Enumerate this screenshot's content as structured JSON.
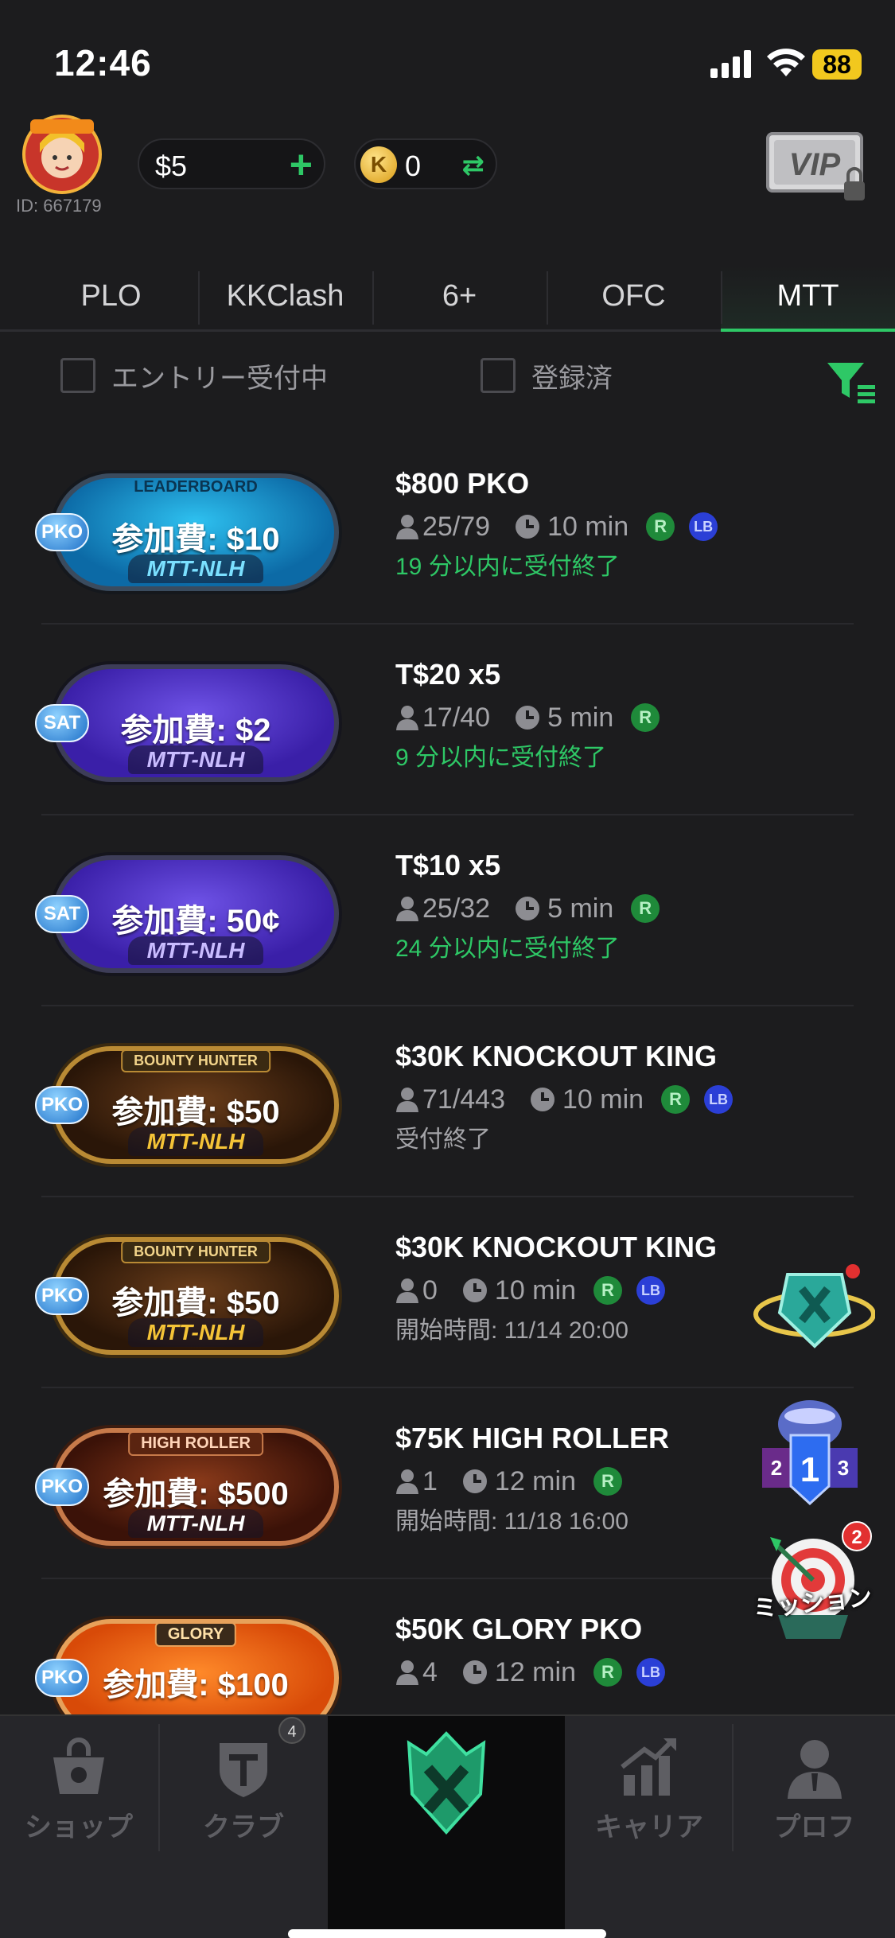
{
  "status_bar": {
    "time": "12:46",
    "battery": "88"
  },
  "header": {
    "user_id": "ID: 667179",
    "cash": "$5",
    "coins": "0",
    "coin_symbol": "K",
    "vip_label": "VIP"
  },
  "tabs": [
    {
      "label": "PLO",
      "active": false
    },
    {
      "label": "KKClash",
      "active": false
    },
    {
      "label": "6+",
      "active": false
    },
    {
      "label": "OFC",
      "active": false
    },
    {
      "label": "MTT",
      "active": true
    }
  ],
  "filters": {
    "entry_open": "エントリー受付中",
    "registered": "登録済"
  },
  "tournaments": [
    {
      "style": "blue",
      "tag": "PKO",
      "top_label": "LEADERBOARD",
      "fee": "参加費: $10",
      "game": "MTT-NLH",
      "title": "$800 PKO",
      "players": "25/79",
      "duration": "10 min",
      "r": true,
      "lb": true,
      "status": "19 分以内に受付終了",
      "status_color": "green"
    },
    {
      "style": "purple",
      "tag": "SAT",
      "top_label": "",
      "fee": "参加費: $2",
      "game": "MTT-NLH",
      "title": "T$20 x5",
      "players": "17/40",
      "duration": "5 min",
      "r": true,
      "lb": false,
      "status": "9 分以内に受付終了",
      "status_color": "green"
    },
    {
      "style": "purple",
      "tag": "SAT",
      "top_label": "",
      "fee": "参加費: 50¢",
      "game": "MTT-NLH",
      "title": "T$10 x5",
      "players": "25/32",
      "duration": "5 min",
      "r": true,
      "lb": false,
      "status": "24 分以内に受付終了",
      "status_color": "green"
    },
    {
      "style": "gold",
      "tag": "PKO",
      "top_label": "BOUNTY HUNTER",
      "fee": "参加費: $50",
      "game": "MTT-NLH",
      "title": "$30K KNOCKOUT KING",
      "players": "71/443",
      "duration": "10 min",
      "r": true,
      "lb": true,
      "status": "受付終了",
      "status_color": "gray"
    },
    {
      "style": "gold",
      "tag": "PKO",
      "top_label": "BOUNTY HUNTER",
      "fee": "参加費: $50",
      "game": "MTT-NLH",
      "title": "$30K KNOCKOUT KING",
      "players": "0",
      "duration": "10 min",
      "r": true,
      "lb": true,
      "status": "開始時間: 11/14 20:00",
      "status_color": "gray"
    },
    {
      "style": "bronze",
      "tag": "PKO",
      "top_label": "HIGH ROLLER",
      "fee": "参加費: $500",
      "game": "MTT-NLH",
      "title": "$75K HIGH ROLLER",
      "players": "1",
      "duration": "12 min",
      "r": true,
      "lb": false,
      "status": "開始時間: 11/18 16:00",
      "status_color": "gray"
    },
    {
      "style": "orange",
      "tag": "PKO",
      "top_label": "GLORY",
      "fee": "参加費: $100",
      "game": "",
      "title": "$50K GLORY PKO",
      "players": "4",
      "duration": "12 min",
      "r": true,
      "lb": true,
      "status": "",
      "status_color": "gray"
    }
  ],
  "badge_icons": {
    "r": "R",
    "lb": "LB"
  },
  "floating": {
    "mission_label": "ミッション",
    "mission_count": "2"
  },
  "bottom_nav": {
    "shop": "ショップ",
    "club": "クラブ",
    "club_badge": "4",
    "career": "キャリア",
    "profile": "プロフ"
  }
}
